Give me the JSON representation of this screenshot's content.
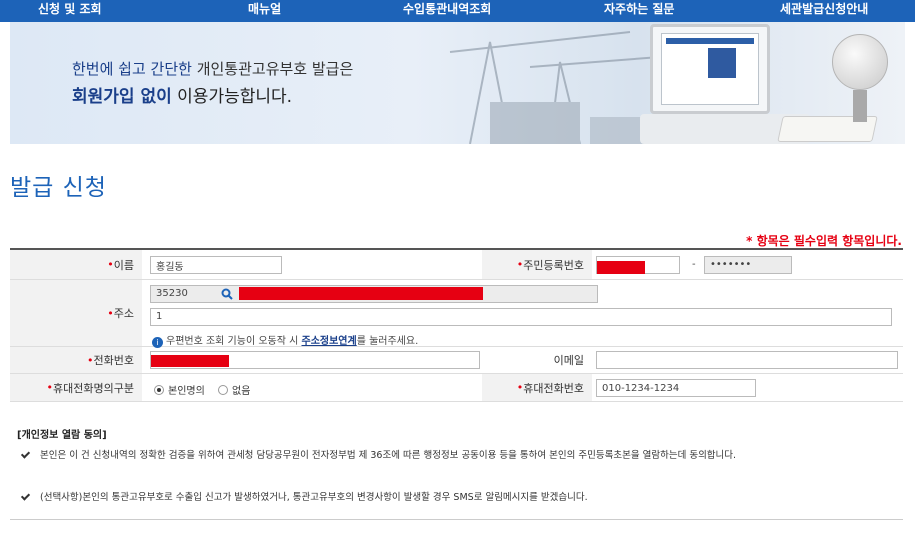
{
  "nav": {
    "items": [
      "신청 및 조회",
      "매뉴얼",
      "수입통관내역조회",
      "자주하는 질문",
      "세관발급신청안내"
    ]
  },
  "banner": {
    "line1_part1": "한번에 쉽고 간단한",
    "line1_part2": " 개인통관고유부호 발급은",
    "line2_part1": "회원가입 없이",
    "line2_part2": " 이용가능합니다."
  },
  "page": {
    "title": "발급 신청",
    "required_note": "* 항목은 필수입력 항목입니다."
  },
  "form": {
    "name": {
      "label": "이름",
      "value": "홍길동"
    },
    "rrn": {
      "label": "주민등록번호",
      "second_value": "•••••••",
      "dash": "-"
    },
    "address": {
      "label": "주소",
      "zipcode": "35230",
      "detail": "1",
      "hint_prefix": "우편번호 조회 기능이 오동작 시 ",
      "hint_link": "주소정보연계",
      "hint_suffix": "를 눌러주세요."
    },
    "phone": {
      "label": "전화번호"
    },
    "email": {
      "label": "이메일",
      "value": ""
    },
    "mobile_owner": {
      "label": "휴대전화명의구분",
      "options": [
        "본인명의",
        "없음"
      ],
      "selected": "본인명의"
    },
    "mobile": {
      "label": "휴대전화번호",
      "value": "010-1234-1234"
    }
  },
  "consent": {
    "title": "[개인정보 열람 동의]",
    "item1": "본인은 이 건 신청내역의 정확한 검증을 위하여 관세청 담당공무원이 전자정부법 제 36조에 따른 행정정보 공동이용 등을 통하여 본인의 주민등록초본을 열람하는데 동의합니다.",
    "item2": "(선택사항)본인의 통관고유부호로 수출입 신고가 발생하였거나, 통관고유부호의 변경사항이 발생할 경우 SMS로 알림메시지를 받겠습니다."
  },
  "colors": {
    "primary": "#1d63b8",
    "required": "#e60012"
  }
}
